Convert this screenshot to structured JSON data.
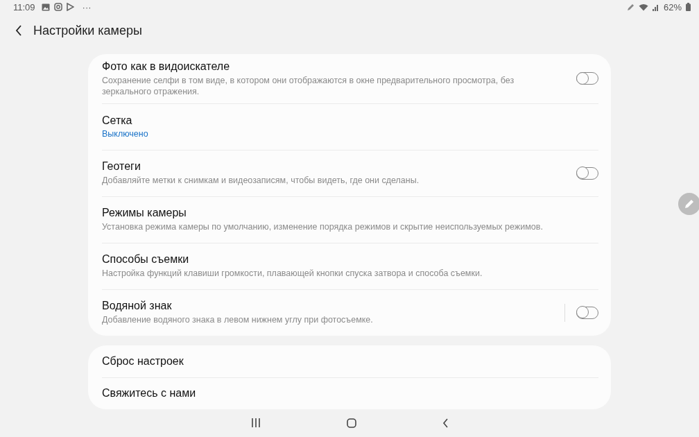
{
  "status_bar": {
    "time": "11:09",
    "more": "···",
    "battery": "62%"
  },
  "header": {
    "title": "Настройки камеры"
  },
  "cards": [
    {
      "items": [
        {
          "kind": "toggle",
          "title": "Фото как в видоискателе",
          "subtitle": "Сохранение селфи в том виде, в котором они отображаются в окне предварительного просмотра, без зеркального отражения.",
          "on": false,
          "divider": false
        },
        {
          "kind": "value",
          "title": "Сетка",
          "value": "Выключено"
        },
        {
          "kind": "toggle",
          "title": "Геотеги",
          "subtitle": "Добавляйте метки к снимкам и видеозаписям, чтобы видеть, где они сделаны.",
          "on": false,
          "divider": false
        },
        {
          "kind": "plain",
          "title": "Режимы камеры",
          "subtitle": "Установка режима камеры по умолчанию, изменение порядка режимов и скрытие неиспользуемых режимов."
        },
        {
          "kind": "plain",
          "title": "Способы съемки",
          "subtitle": "Настройка функций клавиши громкости, плавающей кнопки спуска затвора и способа съемки."
        },
        {
          "kind": "toggle",
          "title": "Водяной знак",
          "subtitle": "Добавление водяного знака в левом нижнем углу при фотосъемке.",
          "on": false,
          "divider": true
        }
      ]
    },
    {
      "items": [
        {
          "kind": "plain",
          "title": "Сброс настроек"
        },
        {
          "kind": "plain",
          "title": "Свяжитесь с нами"
        }
      ]
    }
  ]
}
